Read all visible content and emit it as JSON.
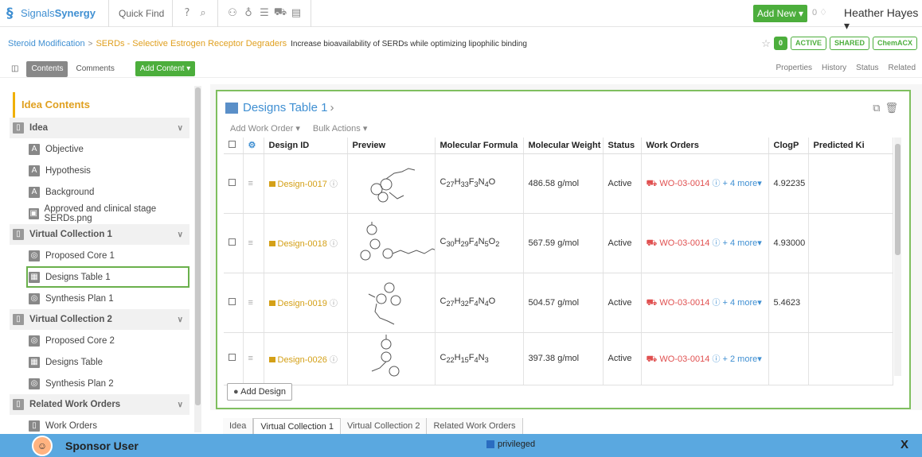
{
  "topbar": {
    "logo_prefix": "Signals",
    "logo_suffix": "Synergy",
    "quick_find": "Quick Find",
    "add_new": "Add New ▾",
    "notif_count": "0",
    "user": "Heather Hayes ▾"
  },
  "breadcrumb": {
    "level1": "Steroid Modification",
    "level2": "SERDs - Selective Estrogen Receptor Degraders",
    "description": "Increase bioavailability of SERDs while optimizing lipophilic binding",
    "badge_count": "0",
    "badge_active": "ACTIVE",
    "badge_shared": "SHARED",
    "badge_chemacx": "ChemACX"
  },
  "toolbar": {
    "contents": "Contents",
    "comments": "Comments",
    "add_content": "Add Content ▾",
    "properties": "Properties",
    "history": "History",
    "status": "Status",
    "related": "Related"
  },
  "sidebar": {
    "heading": "Idea Contents",
    "sections": [
      {
        "label": "Idea",
        "items": [
          "Objective",
          "Hypothesis",
          "Background",
          "Approved and clinical stage SERDs.png"
        ]
      },
      {
        "label": "Virtual Collection 1",
        "items": [
          "Proposed Core 1",
          "Designs Table 1",
          "Synthesis Plan 1"
        ]
      },
      {
        "label": "Virtual Collection 2",
        "items": [
          "Proposed Core 2",
          "Designs Table",
          "Synthesis Plan 2"
        ]
      },
      {
        "label": "Related Work Orders",
        "items": [
          "Work Orders"
        ]
      }
    ]
  },
  "panel": {
    "title": "Designs Table 1",
    "add_work_order": "Add Work Order ▾",
    "bulk_actions": "Bulk Actions ▾",
    "add_design": "Add Design"
  },
  "table": {
    "columns": [
      "Design ID",
      "Preview",
      "Molecular Formula",
      "Molecular Weight",
      "Status",
      "Work Orders",
      "ClogP",
      "Predicted Ki"
    ],
    "rows": [
      {
        "id": "Design-0017",
        "formula": "C27H33F3N4O",
        "weight": "486.58 g/mol",
        "status": "Active",
        "wo": "WO-03-0014",
        "more": "+ 4 more▾",
        "clogp": "4.92235"
      },
      {
        "id": "Design-0018",
        "formula": "C30H29F4N5O2",
        "weight": "567.59 g/mol",
        "status": "Active",
        "wo": "WO-03-0014",
        "more": "+ 4 more▾",
        "clogp": "4.93000"
      },
      {
        "id": "Design-0019",
        "formula": "C27H32F4N4O",
        "weight": "504.57 g/mol",
        "status": "Active",
        "wo": "WO-03-0014",
        "more": "+ 4 more▾",
        "clogp": "5.4623"
      },
      {
        "id": "Design-0026",
        "formula": "C22H15F4N3",
        "weight": "397.38 g/mol",
        "status": "Active",
        "wo": "WO-03-0014",
        "more": "+ 2 more▾",
        "clogp": ""
      }
    ]
  },
  "bottom_tabs": [
    "Idea",
    "Virtual Collection 1",
    "Virtual Collection 2",
    "Related Work Orders"
  ],
  "footer": {
    "user": "Sponsor User",
    "privileged": "privileged",
    "close": "X"
  }
}
